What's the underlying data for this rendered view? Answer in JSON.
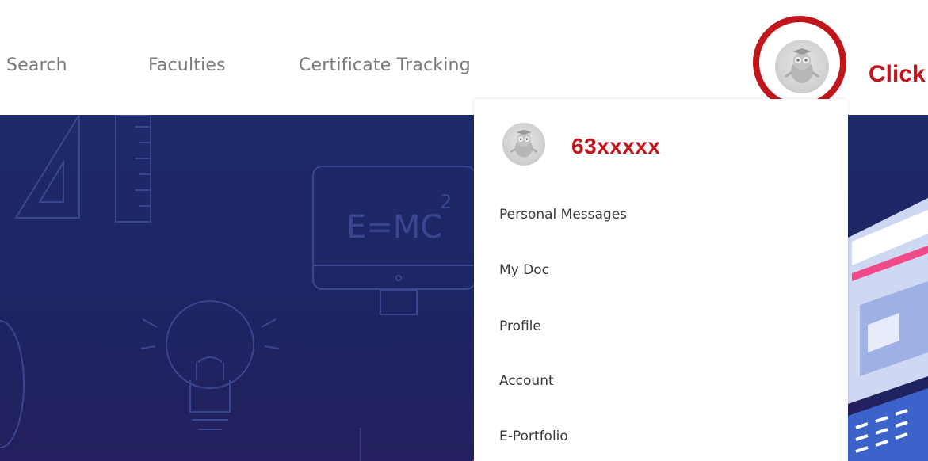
{
  "nav": {
    "items": [
      {
        "label": "Search"
      },
      {
        "label": "Faculties"
      },
      {
        "label": "Certificate Tracking"
      }
    ]
  },
  "user_menu": {
    "avatar_icon": "owl-mascot-avatar",
    "annotation_label": "Click",
    "username": "63xxxxx",
    "items": [
      {
        "label": "Personal Messages"
      },
      {
        "label": "My Doc"
      },
      {
        "label": "Profile"
      },
      {
        "label": "Account"
      },
      {
        "label": "E-Portfolio"
      }
    ]
  },
  "hero": {
    "formula_text": "E=MC",
    "formula_superscript": "2"
  },
  "colors": {
    "annotation_red": "#c0161c",
    "hero_navy": "#1f2a6b",
    "nav_text": "#7a7a7a"
  }
}
